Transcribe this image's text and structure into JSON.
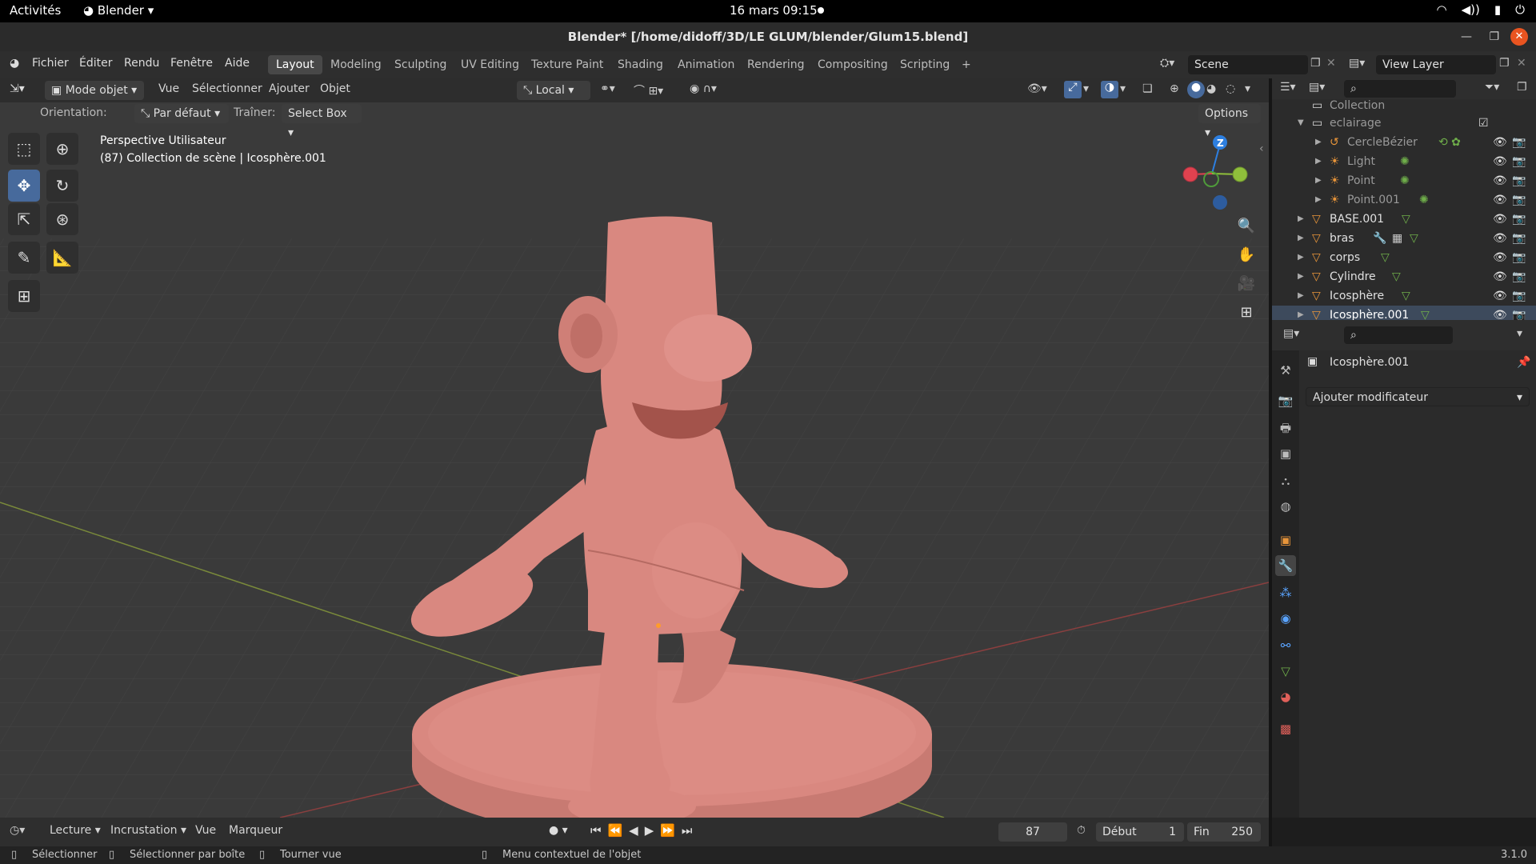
{
  "gnome": {
    "activities": "Activités",
    "app": "Blender",
    "clock": "16 mars  09:15"
  },
  "window": {
    "title": "Blender* [/home/didoff/3D/LE GLUM/blender/Glum15.blend]"
  },
  "menu": {
    "items": [
      "Fichier",
      "Éditer",
      "Rendu",
      "Fenêtre",
      "Aide"
    ]
  },
  "workspaces": {
    "tabs": [
      "Layout",
      "Modeling",
      "Sculpting",
      "UV Editing",
      "Texture Paint",
      "Shading",
      "Animation",
      "Rendering",
      "Compositing",
      "Scripting"
    ],
    "active": "Layout"
  },
  "scene": {
    "name": "Scene",
    "view_layer": "View Layer"
  },
  "viewport": {
    "mode": "Mode objet",
    "menus": [
      "Vue",
      "Sélectionner",
      "Ajouter",
      "Objet"
    ],
    "transform": "Local",
    "orientation_label": "Orientation:",
    "orientation_value": "Par défaut",
    "drag_label": "Traîner:",
    "drag_value": "Select Box",
    "options": "Options",
    "overlay_title": "Perspective Utilisateur",
    "overlay_sub": "(87) Collection de scène | Icosphère.001",
    "gizmo_z": "Z"
  },
  "outliner": {
    "items": [
      {
        "name": "Collection",
        "type": "collection"
      },
      {
        "name": "eclairage",
        "type": "collection"
      },
      {
        "name": "CercleBézier",
        "type": "curve"
      },
      {
        "name": "Light",
        "type": "light"
      },
      {
        "name": "Point",
        "type": "light"
      },
      {
        "name": "Point.001",
        "type": "light"
      },
      {
        "name": "BASE.001",
        "type": "mesh"
      },
      {
        "name": "bras",
        "type": "mesh"
      },
      {
        "name": "corps",
        "type": "mesh"
      },
      {
        "name": "Cylindre",
        "type": "mesh"
      },
      {
        "name": "Icosphère",
        "type": "mesh"
      },
      {
        "name": "Icosphère.001",
        "type": "mesh"
      }
    ]
  },
  "properties": {
    "object": "Icosphère.001",
    "add_modifier": "Ajouter modificateur"
  },
  "timeline": {
    "menus": [
      "Lecture",
      "Incrustation",
      "Vue",
      "Marqueur"
    ],
    "current_frame": "87",
    "start_label": "Début",
    "start": "1",
    "end_label": "Fin",
    "end": "250"
  },
  "status": {
    "select": "Sélectionner",
    "box": "Sélectionner par boîte",
    "rotate": "Tourner vue",
    "context": "Menu contextuel de l'objet",
    "version": "3.1.0"
  },
  "colors": {
    "accent": "#476a9c",
    "model": "#d98880",
    "bg": "#3a3a3a"
  }
}
